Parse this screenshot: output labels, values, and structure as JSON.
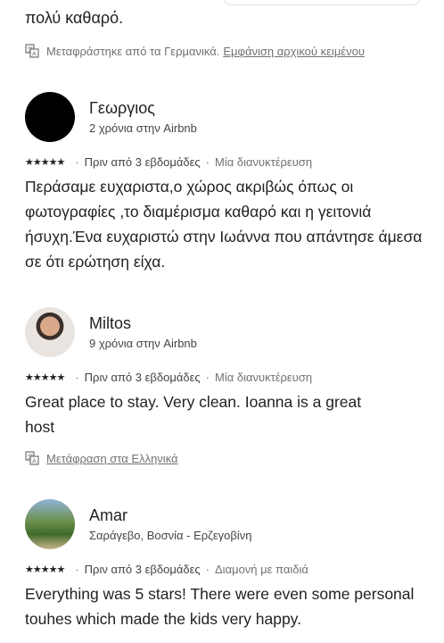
{
  "top": {
    "fragment_text": "πολύ καθαρό.",
    "translated_note": "Μεταφράστηκε από τα Γερμανικά.",
    "show_original_link": "Εμφάνιση αρχικού κειμένου"
  },
  "reviews": [
    {
      "name": "Γεωργιος",
      "meta": "2 χρόνια στην Airbnb",
      "stars": "★★★★★",
      "when": "Πριν από 3 εβδομάδες",
      "stay": "Μία διανυκτέρευση",
      "text": "Περάσαμε ευχαριστα,ο χώρος ακριβώς όπως οι φωτογραφίες ,το διαμέρισμα καθαρό και η γειτονιά ήσυχη.Ένα  ευχαριστώ στην Ιωάννα που απάντησε άμεσα σε ότι ερώτηση είχα."
    },
    {
      "name": "Miltos",
      "meta": "9 χρόνια στην Airbnb",
      "stars": "★★★★★",
      "when": "Πριν από 3 εβδομάδες",
      "stay": "Μία διανυκτέρευση",
      "text": "Great place to stay. Very clean. Ioanna is a great host",
      "translate_link": "Μετάφραση στα Ελληνικά"
    },
    {
      "name": "Amar",
      "meta": "Σαράγεβο, Βοσνία - Ερζεγοβίνη",
      "stars": "★★★★★",
      "when": "Πριν από 3 εβδομάδες",
      "stay": "Διαμονή με παιδιά",
      "text": "Everything was 5 stars! There were even some personal touhes which made the kids very happy."
    }
  ]
}
